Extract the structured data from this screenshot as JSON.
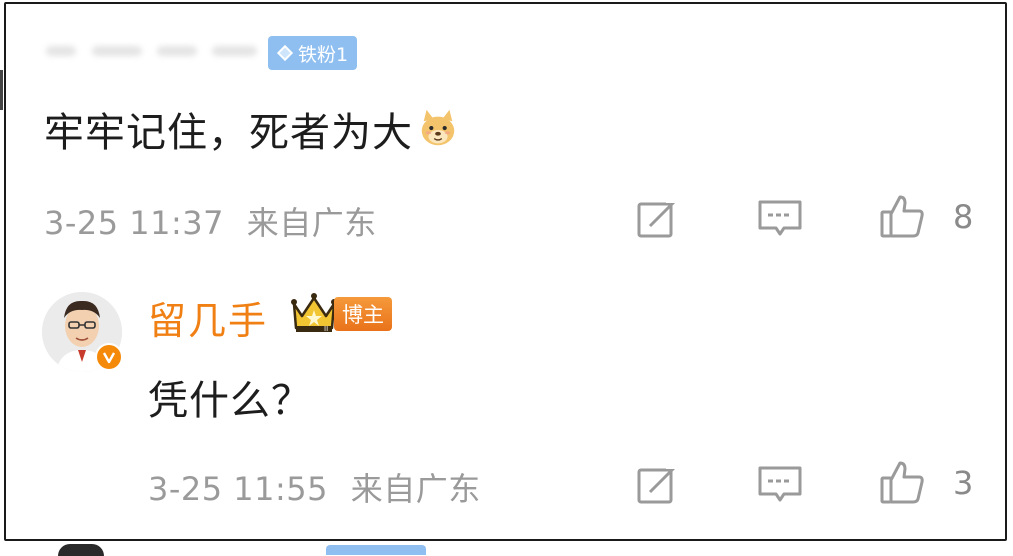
{
  "comment_top": {
    "fan_badge": {
      "label": "铁粉1",
      "icon": "diamond-icon"
    },
    "text": "牢牢记住，死者为大",
    "emoji": "doge-emoji",
    "time": "3-25 11:37",
    "location": "来自广东",
    "actions": {
      "share_icon": "share-icon",
      "comment_icon": "comment-icon",
      "like_icon": "thumbs-up-icon"
    },
    "likes": "8"
  },
  "reply": {
    "author": "留几手",
    "crown_icon": "crown-icon",
    "blogger_badge": "博主",
    "verified_icon": "verified-v-icon",
    "text": "凭什么？",
    "time": "3-25 11:55",
    "location": "来自广东",
    "likes": "3"
  },
  "colors": {
    "author": "#f07f14",
    "fan_badge": "#8fbff0",
    "meta_text": "#9a9a9a",
    "body_text": "#1d1d1d"
  }
}
